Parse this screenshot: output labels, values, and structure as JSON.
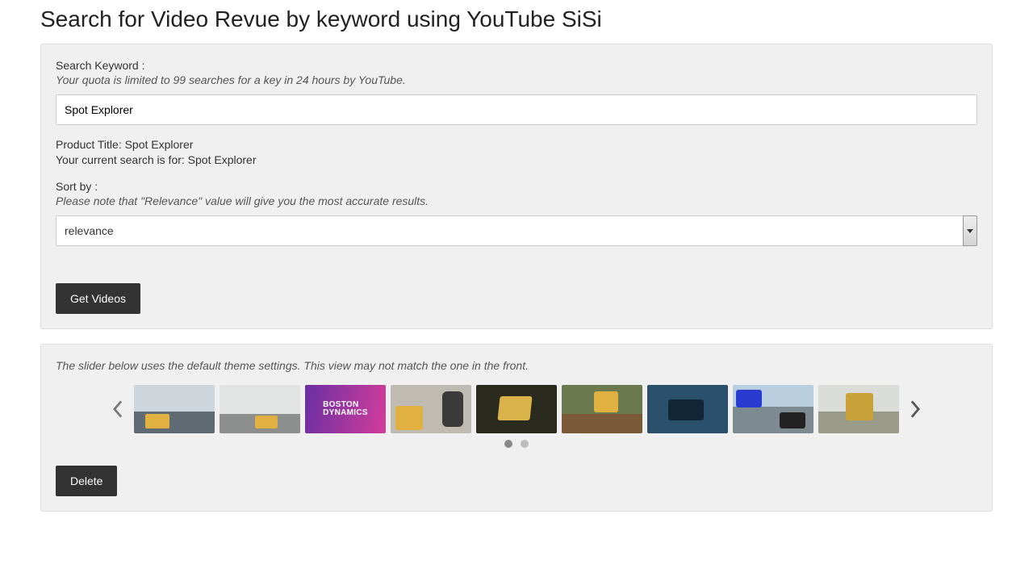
{
  "page": {
    "title": "Search for Video Revue by keyword using YouTube SiSi"
  },
  "searchPanel": {
    "keywordLabel": "Search Keyword :",
    "quotaHint": "Your quota is limited to 99 searches for a key in 24 hours by YouTube.",
    "keywordValue": "Spot Explorer",
    "productTitleLine": "Product Title: Spot Explorer",
    "currentSearchLine": "Your current search is for: Spot Explorer",
    "sortLabel": "Sort by :",
    "sortHint": "Please note that \"Relevance\" value will give you the most accurate results.",
    "sortValue": "relevance",
    "submitLabel": "Get Videos"
  },
  "sliderPanel": {
    "hint": "The slider below uses the default theme settings. This view may not match the one in the front.",
    "thumb3Text": "BOSTON\nDYNAMICS",
    "deleteLabel": "Delete"
  }
}
